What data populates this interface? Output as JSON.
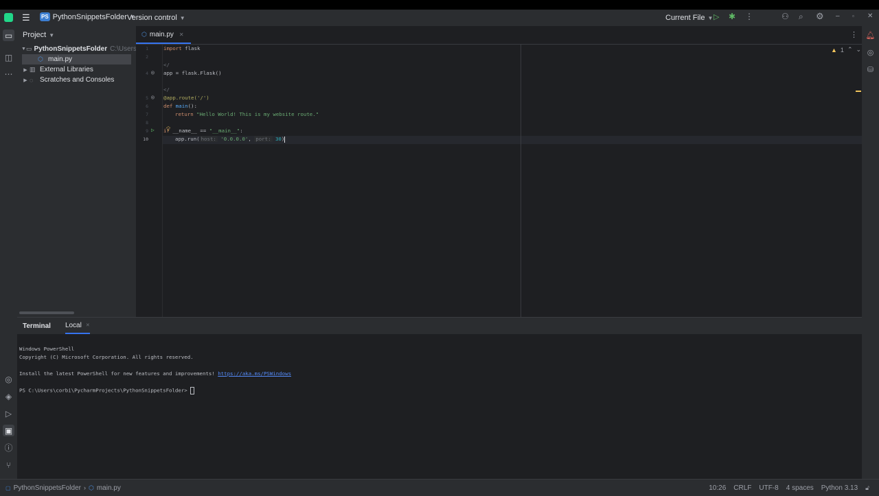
{
  "titlebar": {
    "project_badge": "PS",
    "project_name": "PythonSnippetsFolder",
    "vcs_label": "Version control",
    "run_config": "Current File"
  },
  "project_panel": {
    "title": "Project",
    "root": {
      "name": "PythonSnippetsFolder",
      "path": "C:\\Users\\c"
    },
    "file": "main.py",
    "items": [
      "External Libraries",
      "Scratches and Consoles"
    ]
  },
  "editor": {
    "tab_name": "main.py",
    "warnings": "1",
    "line_numbers": [
      "1",
      "2",
      "",
      "4",
      "",
      "",
      "5",
      "6",
      "7",
      "8",
      "9",
      "10"
    ],
    "inlay_hint": "</",
    "lines": {
      "l1_kw": "import",
      "l1_mod": " flask",
      "l4": "app = flask.Flask()",
      "l5_dec": "@app.route('/')",
      "l6_kw": "def",
      "l6_fn": " main",
      "l6_rest": "():",
      "l7_kw": "return",
      "l7_str": "\"Hello World! This is my website route.\"",
      "l9_kw": "if",
      "l9_name": " __name__ == ",
      "l9_str": "\"__main__\"",
      "l9_end": ":",
      "l10_a": "app.run(",
      "l10_hint1": "host:",
      "l10_str": " '0.0.0.0'",
      "l10_comma": ", ",
      "l10_hint2": "port:",
      "l10_num": " 30",
      "l10_end": ")"
    }
  },
  "terminal": {
    "tab_terminal": "Terminal",
    "tab_local": "Local",
    "lines": [
      "Windows PowerShell",
      "Copyright (C) Microsoft Corporation. All rights reserved.",
      "Install the latest PowerShell for new features and improvements! "
    ],
    "link": "https://aka.ms/PSWindows",
    "prompt": "PS C:\\Users\\corbi\\PycharmProjects\\PythonSnippetsFolder> "
  },
  "statusbar": {
    "breadcrumb_project": "PythonSnippetsFolder",
    "breadcrumb_file": "main.py",
    "position": "10:26",
    "line_sep": "CRLF",
    "encoding": "UTF-8",
    "indent": "4 spaces",
    "interpreter": "Python 3.13"
  }
}
